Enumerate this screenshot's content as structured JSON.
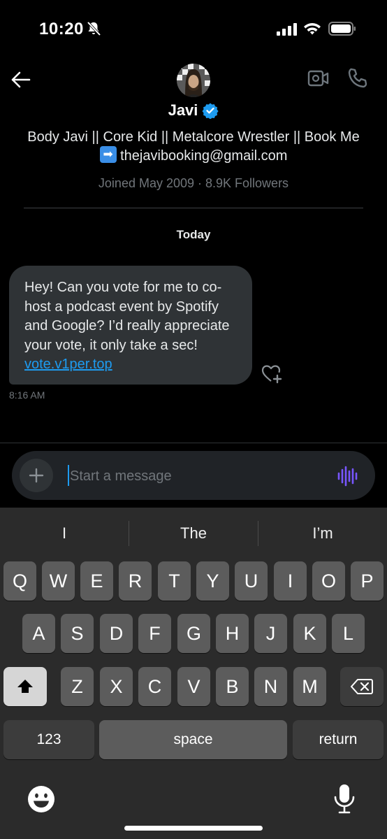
{
  "status_bar": {
    "time": "10:20"
  },
  "header": {
    "name": "Javi",
    "bio_part1": "Body Javi || Core Kid || Metalcore Wrestler || Book Me",
    "bio_email": "thejavibooking@gmail.com",
    "meta": "Joined May 2009 · 8.9K Followers"
  },
  "conversation": {
    "date_separator": "Today",
    "messages": [
      {
        "text": "Hey! Can you vote for me to co-host a podcast event by Spotify and Google? I’d really appreciate your vote, it only take a sec!",
        "link": "vote.v1per.top",
        "time": "8:16 AM"
      }
    ]
  },
  "composer": {
    "placeholder": "Start a message"
  },
  "keyboard": {
    "suggestions": [
      "I",
      "The",
      "I’m"
    ],
    "row1": [
      "Q",
      "W",
      "E",
      "R",
      "T",
      "Y",
      "U",
      "I",
      "O",
      "P"
    ],
    "row2": [
      "A",
      "S",
      "D",
      "F",
      "G",
      "H",
      "J",
      "K",
      "L"
    ],
    "row3": [
      "Z",
      "X",
      "C",
      "V",
      "B",
      "N",
      "M"
    ],
    "numbers_label": "123",
    "space_label": "space",
    "return_label": "return"
  },
  "colors": {
    "accent": "#1d9bf0",
    "bubble": "#2f3336",
    "voice_accent": "#7856ff"
  }
}
